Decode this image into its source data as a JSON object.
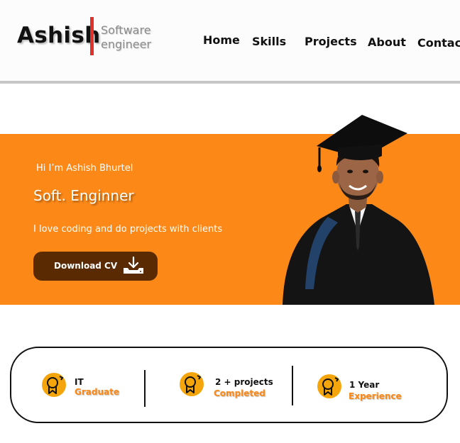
{
  "brand": {
    "name": "Ashish",
    "role_line1": "Software",
    "role_line2": "engineer",
    "accent_color": "#e0312b"
  },
  "nav": {
    "home": "Home",
    "skills": "Skills",
    "projects": "Projects",
    "about": "About",
    "contact": "Contact"
  },
  "hero": {
    "greeting": "Hi I’m Ashish Bhurtel",
    "title": "Soft. Enginner",
    "tagline": "I love coding and do projects with clients",
    "button_label": "Download CV",
    "button_icon": "download-tray-icon",
    "background_color": "#fb8817",
    "button_color": "#5a2a03"
  },
  "stats": [
    {
      "line1": "IT",
      "line2": "Graduate",
      "icon": "award-badge-icon"
    },
    {
      "line1": "2 + projects",
      "line2": "Completed",
      "icon": "award-badge-icon"
    },
    {
      "line1": "1 Year",
      "line2": "Experience",
      "icon": "award-badge-icon"
    }
  ]
}
